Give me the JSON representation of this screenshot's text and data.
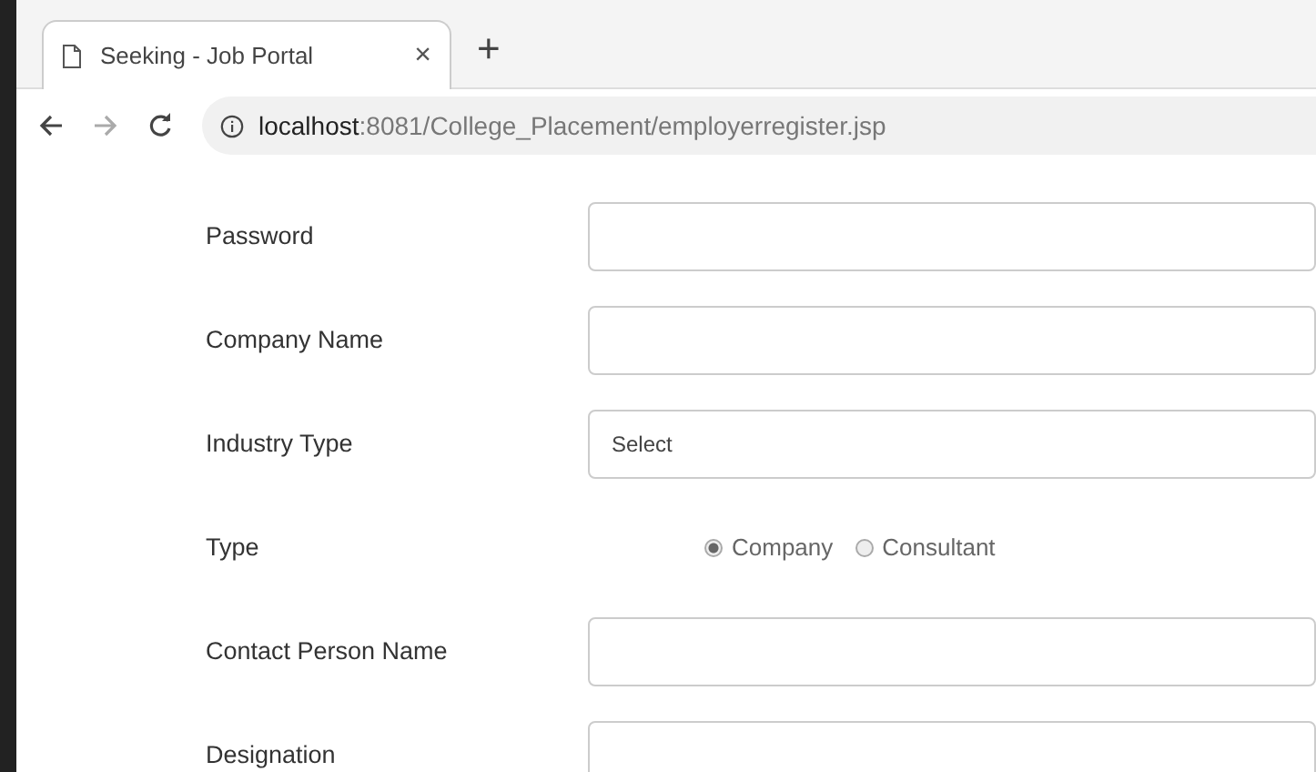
{
  "tab": {
    "title": "Seeking - Job Portal",
    "close": "×",
    "new_tab": "+"
  },
  "address_bar": {
    "host": "localhost",
    "path": ":8081/College_Placement/employerregister.jsp"
  },
  "form": [
    {
      "kind": "text",
      "label": "Password"
    },
    {
      "kind": "text",
      "label": "Company Name"
    },
    {
      "kind": "select",
      "label": "Industry Type",
      "value": "Select"
    },
    {
      "kind": "radio",
      "label": "Type",
      "options": [
        {
          "label": "Company",
          "selected": true
        },
        {
          "label": "Consultant",
          "selected": false
        }
      ]
    },
    {
      "kind": "text",
      "label": "Contact Person Name"
    },
    {
      "kind": "text",
      "label": "Designation"
    }
  ]
}
